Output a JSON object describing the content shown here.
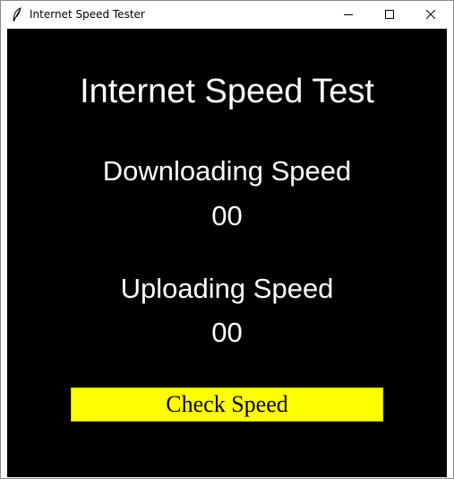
{
  "window": {
    "title": "Internet Speed Tester",
    "icon": "feather-icon",
    "controls": {
      "minimize": "minimize-icon",
      "maximize": "maximize-icon",
      "close": "close-icon"
    }
  },
  "app": {
    "heading": "Internet Speed Test",
    "download": {
      "label": "Downloading Speed",
      "value": "00"
    },
    "upload": {
      "label": "Uploading Speed",
      "value": "00"
    },
    "check_button_label": "Check Speed"
  },
  "colors": {
    "background": "#000000",
    "text": "#ffffff",
    "button_bg": "#ffff00",
    "button_text": "#000000"
  }
}
